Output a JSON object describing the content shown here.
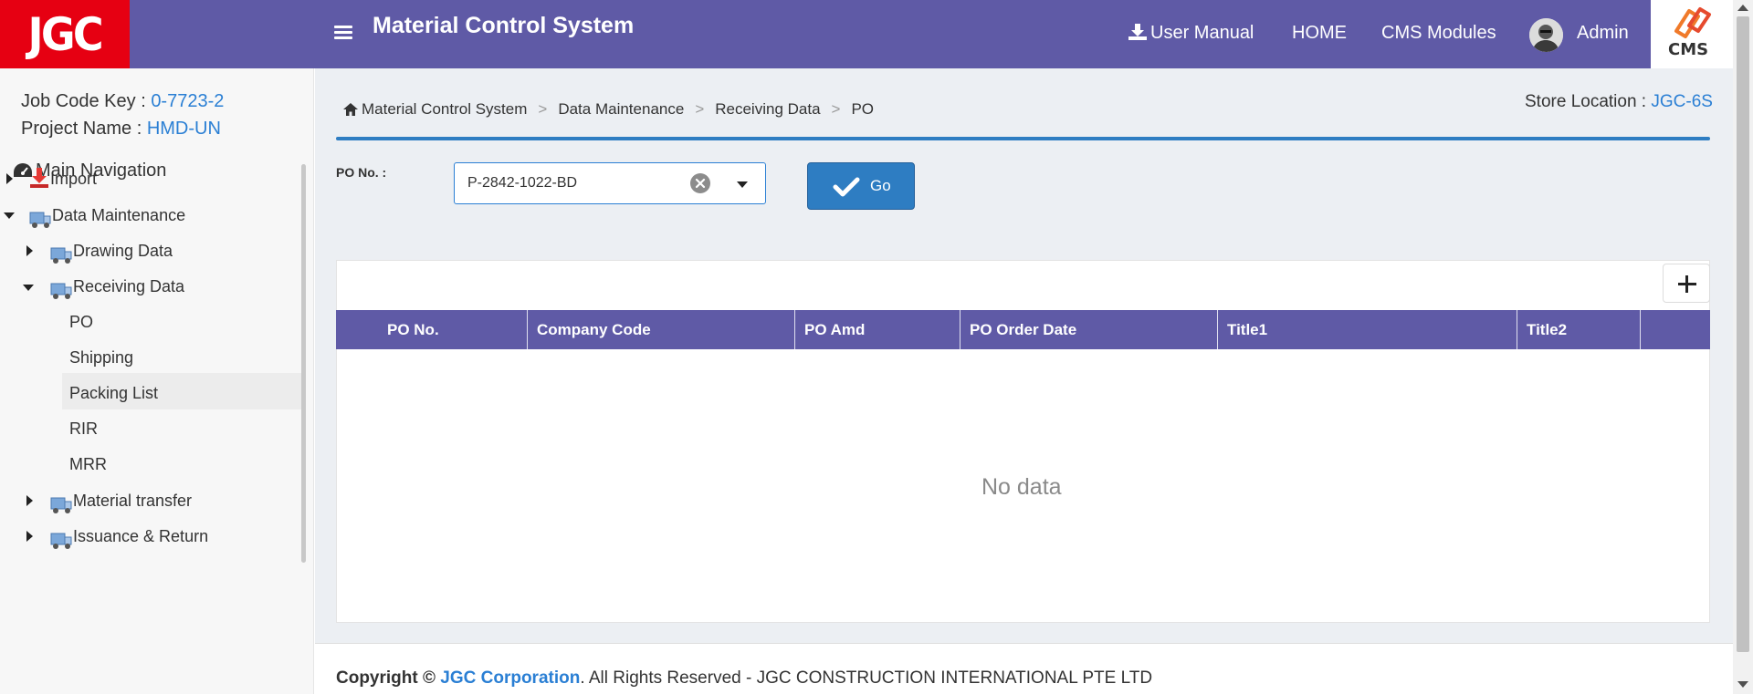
{
  "header": {
    "logo_text": "JGC",
    "title": "Material Control System",
    "user_manual": "User Manual",
    "home": "HOME",
    "cms_modules": "CMS Modules",
    "admin": "Admin",
    "cms_logo_text": "CMS"
  },
  "sidebar": {
    "job_code_label": "Job Code Key :",
    "job_code_value": "0-7723-2",
    "project_label": "Project Name :",
    "project_value": "HMD-UN",
    "main_navigation": "Main Navigation",
    "items": [
      {
        "label": "Import"
      },
      {
        "label": "Data Maintenance"
      },
      {
        "label": "Drawing Data"
      },
      {
        "label": "Receiving Data"
      },
      {
        "label": "PO"
      },
      {
        "label": "Shipping"
      },
      {
        "label": "Packing List"
      },
      {
        "label": "RIR"
      },
      {
        "label": "MRR"
      },
      {
        "label": "Material transfer"
      },
      {
        "label": "Issuance & Return"
      }
    ]
  },
  "breadcrumb": [
    "Material Control System",
    "Data Maintenance",
    "Receiving Data",
    "PO"
  ],
  "breadcrumb_sep": ">",
  "store": {
    "label": "Store Location :",
    "value": "JGC-6S"
  },
  "filter": {
    "po_label": "PO No. :",
    "po_value": "P-2842-1022-BD",
    "go_label": "Go"
  },
  "grid": {
    "columns": [
      "PO No.",
      "Company Code",
      "PO Amd",
      "PO Order Date",
      "Title1",
      "Title2"
    ],
    "empty_text": "No data"
  },
  "footer": {
    "copyright": "Copyright ©",
    "corp": "JGC Corporation",
    "rest": ". All Rights Reserved - JGC CONSTRUCTION INTERNATIONAL PTE LTD"
  },
  "colors": {
    "header_bg": "#5f5aa6",
    "jgc_red": "#e60012",
    "accent_blue": "#2e7dc2",
    "link_blue": "#2a7fd4"
  }
}
